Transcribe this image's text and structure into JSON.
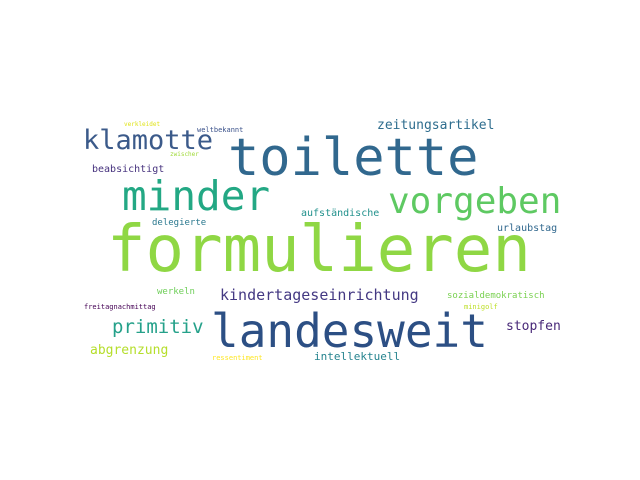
{
  "words": [
    {
      "text": "formulieren",
      "color": "#8fd744"
    },
    {
      "text": "toilette",
      "color": "#31688e"
    },
    {
      "text": "landesweit",
      "color": "#2c4f84"
    },
    {
      "text": "minder",
      "color": "#23a884"
    },
    {
      "text": "vorgeben",
      "color": "#5ec962"
    },
    {
      "text": "klamotte",
      "color": "#3b5a8a"
    },
    {
      "text": "primitiv",
      "color": "#25a18a"
    },
    {
      "text": "kindertageseinrichtung",
      "color": "#443983"
    },
    {
      "text": "zeitungsartikel",
      "color": "#2e6d8e"
    },
    {
      "text": "abgrenzung",
      "color": "#b5de2b"
    },
    {
      "text": "stopfen",
      "color": "#482878"
    },
    {
      "text": "intellektuell",
      "color": "#25838e"
    },
    {
      "text": "beabsichtigt",
      "color": "#46327e"
    },
    {
      "text": "aufständische",
      "color": "#21918c"
    },
    {
      "text": "urlaubstag",
      "color": "#31688e"
    },
    {
      "text": "delegierte",
      "color": "#2a788e"
    },
    {
      "text": "werkeln",
      "color": "#6ece58"
    },
    {
      "text": "sozialdemokratisch",
      "color": "#7ad151"
    },
    {
      "text": "freitagnachmittag",
      "color": "#440154"
    },
    {
      "text": "minigolf",
      "color": "#bddf26"
    },
    {
      "text": "ressentiment",
      "color": "#fde725"
    },
    {
      "text": "weltbekannt",
      "color": "#3b528b"
    },
    {
      "text": "verkleidet",
      "color": "#dfe318"
    },
    {
      "text": "zwischer",
      "color": "#a0da39"
    }
  ]
}
